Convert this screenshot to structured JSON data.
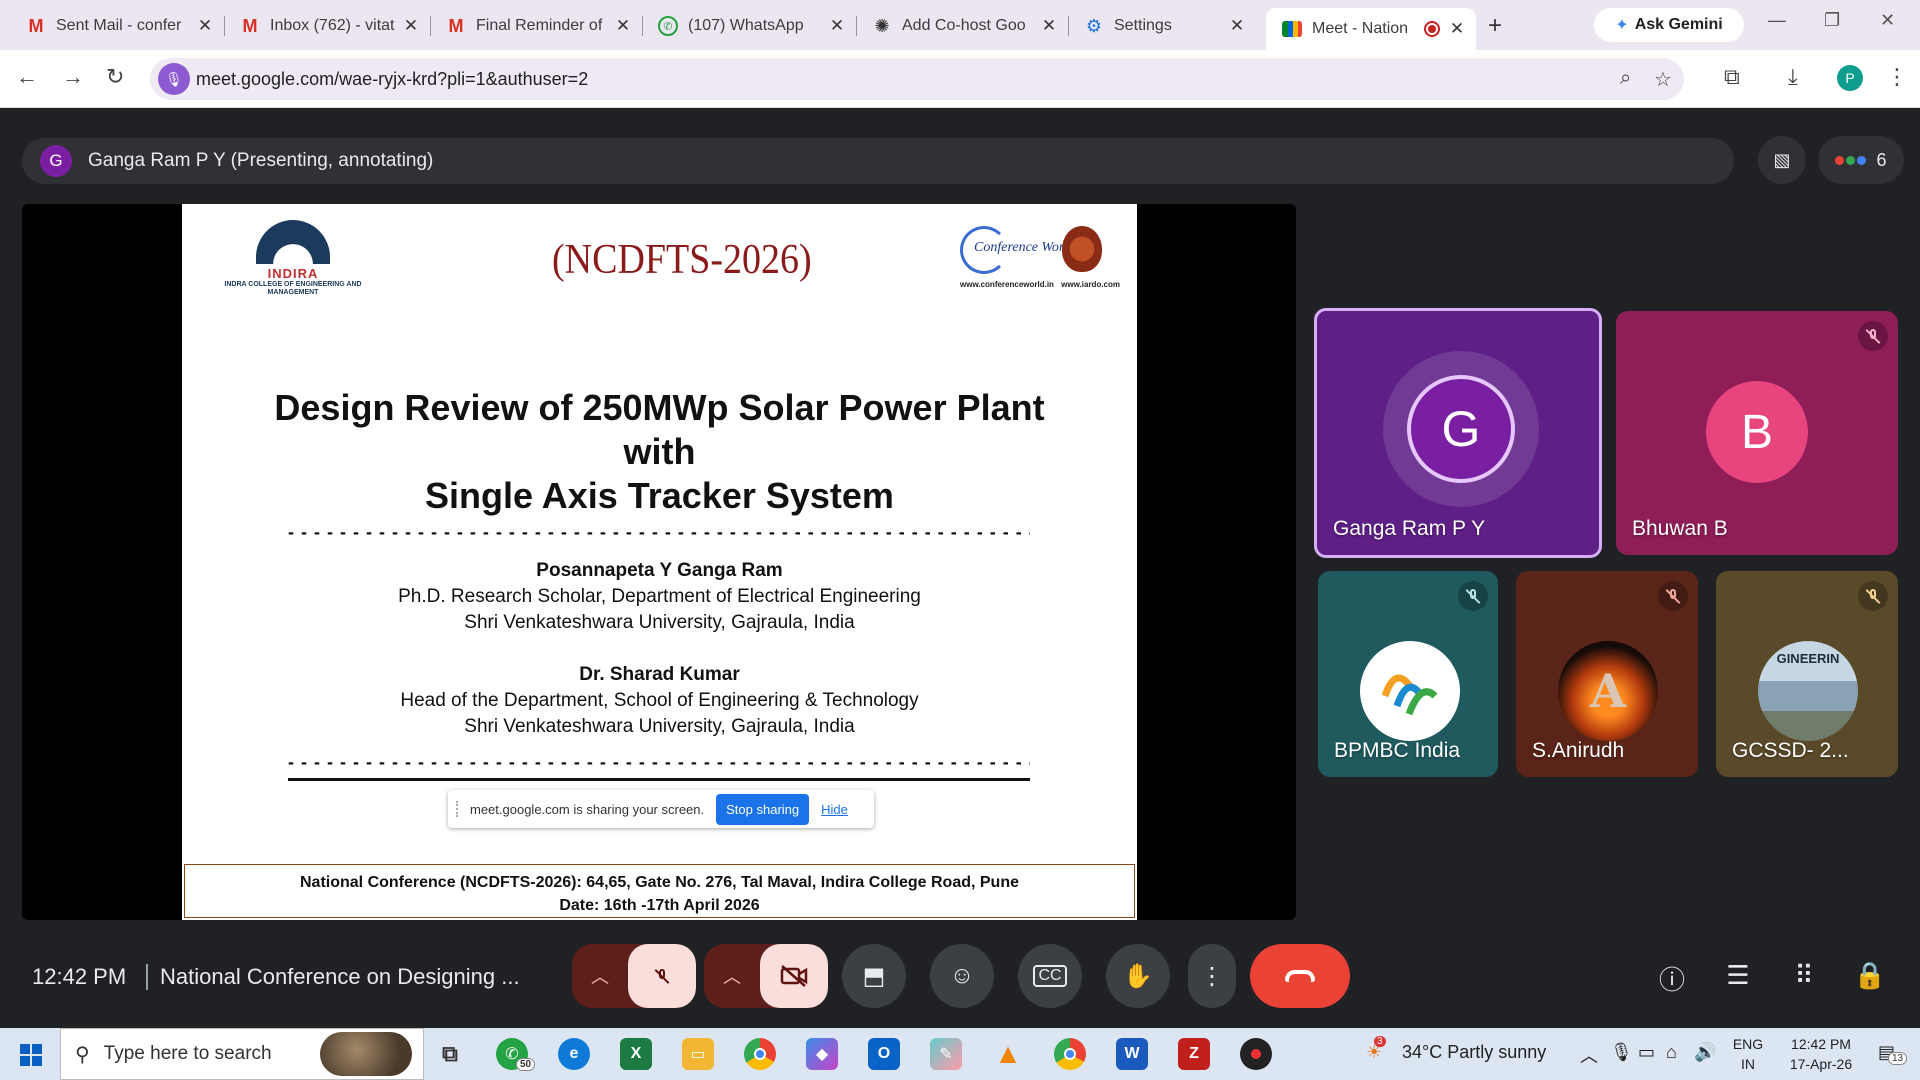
{
  "browser": {
    "tabs": [
      {
        "title": "Sent Mail - confer",
        "icon": "gmail-icon"
      },
      {
        "title": "Inbox (762) - vitat",
        "icon": "gmail-icon"
      },
      {
        "title": "Final Reminder of",
        "icon": "gmail-icon"
      },
      {
        "title": "(107) WhatsApp",
        "icon": "whatsapp-icon"
      },
      {
        "title": "Add Co-host Goo",
        "icon": "openai-icon"
      },
      {
        "title": "Settings",
        "icon": "gear-icon"
      },
      {
        "title": "Meet - Nation",
        "icon": "meet-icon",
        "active": true
      }
    ],
    "gemini_label": "Ask Gemini",
    "url": "meet.google.com/wae-ryjx-krd?pli=1&authuser=2",
    "profile_initial": "P"
  },
  "meet": {
    "presenter_initial": "G",
    "presenter_label": "Ganga Ram P Y (Presenting, annotating)",
    "participant_count": "6",
    "slide": {
      "logo_left_word": "INDIRA",
      "logo_left_sub": "INDRA COLLEGE OF ENGINEERING AND MANAGEMENT",
      "conf_code": "(NCDFTS-2026)",
      "logo_right_text": "Conference World",
      "logo_right_url1": "www.conferenceworld.in",
      "logo_right_url2": "www.iardo.com",
      "title_line1": "Design Review of 250MWp Solar Power Plant",
      "title_line2": "with",
      "title_line3": "Single Axis Tracker System",
      "author1_name": "Posannapeta Y Ganga Ram",
      "author1_line1": "Ph.D. Research Scholar, Department of Electrical Engineering",
      "author1_line2": "Shri Venkateshwara University, Gajraula, India",
      "author2_name": "Dr. Sharad Kumar",
      "author2_line1": "Head of the Department, School of Engineering & Technology",
      "author2_line2": "Shri Venkateshwara University, Gajraula, India",
      "footer_line1": "National Conference (NCDFTS-2026): 64,65, Gate No. 276, Tal Maval, Indira College Road, Pune",
      "footer_line2": "Date: 16th -17th April 2026"
    },
    "share_bar": {
      "text": "meet.google.com is sharing your screen.",
      "stop_label": "Stop sharing",
      "hide_label": "Hide"
    },
    "tiles": [
      {
        "name": "Ganga Ram P Y",
        "initial": "G",
        "color": "#7b1fa2"
      },
      {
        "name": "Bhuwan B",
        "initial": "B",
        "color": "#e8457e"
      },
      {
        "name": "BPMBC India"
      },
      {
        "name": "S.Anirudh"
      },
      {
        "name": "GCSSD- 2...",
        "logo_text": "GINEERIN"
      }
    ],
    "time": "12:42 PM",
    "meeting_title": "National Conference on Designing ..."
  },
  "taskbar": {
    "search_placeholder": "Type here to search",
    "whatsapp_badge": "50",
    "weather_badge": "3",
    "weather": "34°C  Partly sunny",
    "lang1": "ENG",
    "lang2": "IN",
    "clock_time": "12:42 PM",
    "clock_date": "17-Apr-26",
    "notif_count": "13"
  }
}
